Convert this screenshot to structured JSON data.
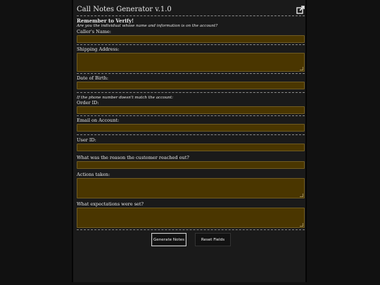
{
  "app": {
    "title": "Call Notes Generator v.1.0"
  },
  "reminder": {
    "heading": "Remember to Verify!",
    "subtext": "Are you the individual whose name and information is on the account?"
  },
  "fields": {
    "caller_name": {
      "label": "Caller's Name:",
      "value": ""
    },
    "shipping_address": {
      "label": "Shipping Address:",
      "value": ""
    },
    "date_of_birth": {
      "label": "Date of Birth:",
      "value": ""
    },
    "phone_note": "If the phone number doesn't match the account:",
    "order_id": {
      "label": "Order ID:",
      "value": ""
    },
    "email_on_account": {
      "label": "Email on Account:",
      "value": ""
    },
    "user_id": {
      "label": "User ID:",
      "value": ""
    },
    "reason": {
      "label": "What was the reason the customer reached out?",
      "value": ""
    },
    "actions_taken": {
      "label": "Actions taken:",
      "value": ""
    },
    "expectations": {
      "label": "What expectations were set?",
      "value": ""
    }
  },
  "buttons": {
    "generate": "Generate Notes",
    "reset": "Reset Fields"
  },
  "icons": {
    "header_action": "external-link-icon"
  },
  "colors": {
    "field_bg": "#4a3600",
    "panel_bg": "#1a1a1a",
    "page_bg": "#111111"
  }
}
